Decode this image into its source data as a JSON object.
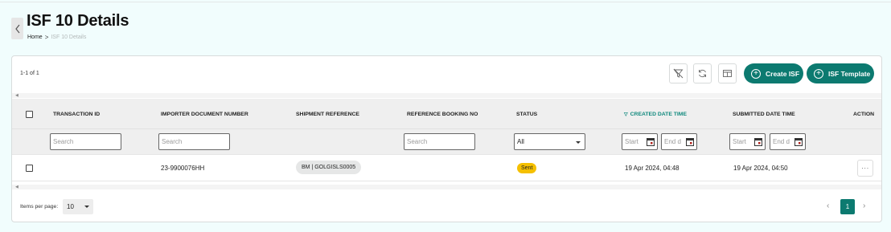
{
  "page": {
    "title": "ISF 10 Details",
    "breadcrumb": {
      "home": "Home",
      "separator": ">",
      "current": "ISF 10 Details"
    }
  },
  "toolbar": {
    "range_label": "1-1 of 1",
    "clear_filter_icon": "filter-off-icon",
    "refresh_icon": "refresh-icon",
    "columns_icon": "columns-layout-icon",
    "create_label": "Create ISF",
    "template_label": "ISF Template",
    "accent": "#0c7a70"
  },
  "table": {
    "columns": {
      "transaction_id": "TRANSACTION ID",
      "importer_doc": "IMPORTER DOCUMENT NUMBER",
      "shipment_ref": "SHIPMENT REFERENCE",
      "booking_no": "REFERENCE BOOKING NO",
      "status": "STATUS",
      "created": "CREATED DATE TIME",
      "submitted": "SUBMITTED DATE TIME",
      "action": "ACTION"
    },
    "sort_indicator": "▽",
    "filters": {
      "search_placeholder": "Search",
      "status_value": "All",
      "start_placeholder": "Start",
      "end_placeholder": "End d"
    },
    "rows": [
      {
        "transaction_id": "",
        "importer_doc": "23-9900076HH",
        "shipment_ref": "BM | GOLGISLS0005",
        "booking_no": "",
        "status": "Sent",
        "created": "19 Apr 2024, 04:48",
        "submitted": "19 Apr 2024, 04:50",
        "action": "···"
      }
    ],
    "status_color": "#f5c000"
  },
  "footer": {
    "items_per_page_label": "Items per page:",
    "items_per_page_value": "10",
    "current_page": "1",
    "prev": "‹",
    "next": "›"
  }
}
